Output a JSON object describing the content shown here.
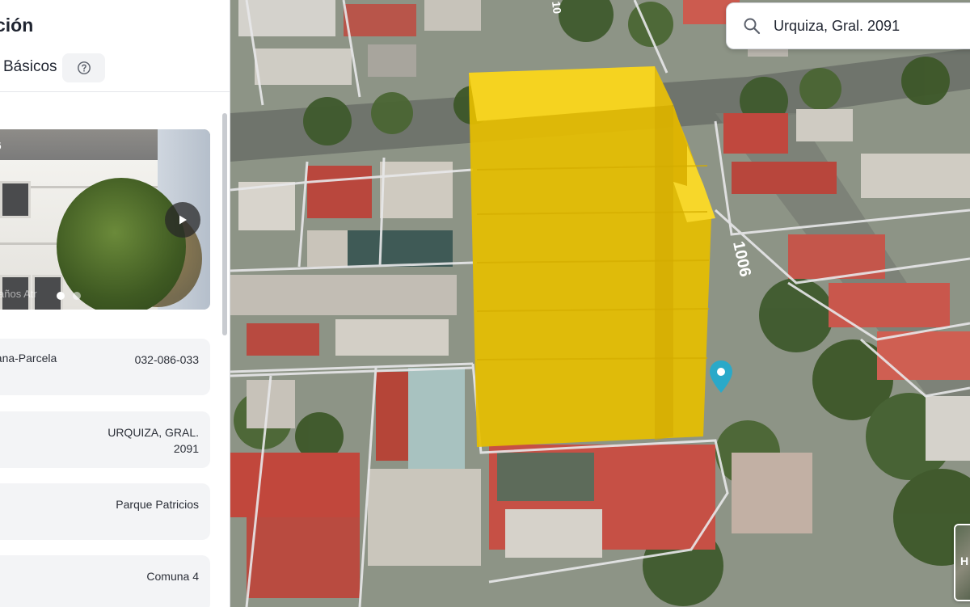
{
  "panel": {
    "title": "ción",
    "tab_label": "Básicos",
    "help_icon": "question-circle-icon"
  },
  "photo": {
    "counter": "6",
    "watermark": "años Atr",
    "play_icon": "play-icon",
    "dots": [
      {
        "active": true
      },
      {
        "active": false
      }
    ]
  },
  "info_cards": [
    {
      "label": "nzana-Parcela",
      "value": "032-086-033"
    },
    {
      "label": "",
      "value": "URQUIZA, GRAL. 2091"
    },
    {
      "label": "",
      "value": "Parque Patricios"
    },
    {
      "label": "",
      "value": "Comuna 4"
    }
  ],
  "search": {
    "value": "Urquiza, Gral. 2091",
    "icon": "search-icon"
  },
  "map": {
    "street_label": "1006",
    "street_label_top": "10",
    "building_color": "#f2c500",
    "pin_color": "#2aa9c9",
    "pin_icon": "location-pin-icon",
    "layer_label": "H"
  }
}
